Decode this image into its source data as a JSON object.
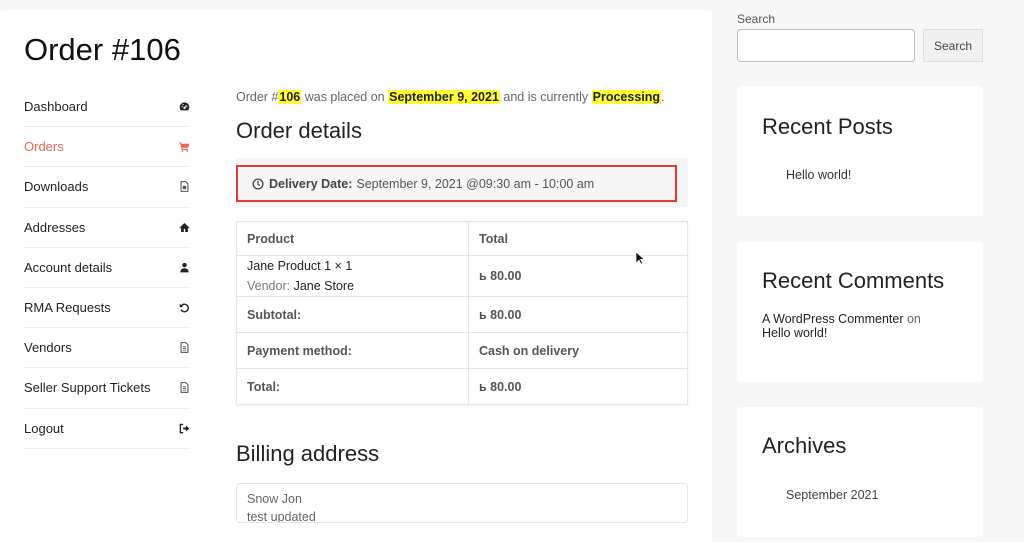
{
  "page": {
    "title": "Order #106"
  },
  "account_nav": {
    "items": [
      {
        "label": "Dashboard",
        "icon": "dashboard-icon",
        "active": false
      },
      {
        "label": "Orders",
        "icon": "cart-icon",
        "active": true
      },
      {
        "label": "Downloads",
        "icon": "file-icon",
        "active": false
      },
      {
        "label": "Addresses",
        "icon": "home-icon",
        "active": false
      },
      {
        "label": "Account details",
        "icon": "user-icon",
        "active": false
      },
      {
        "label": "RMA Requests",
        "icon": "undo-icon",
        "active": false
      },
      {
        "label": "Vendors",
        "icon": "file-icon",
        "active": false
      },
      {
        "label": "Seller Support Tickets",
        "icon": "file-icon",
        "active": false
      },
      {
        "label": "Logout",
        "icon": "logout-icon",
        "active": false
      }
    ],
    "active_color": "#e26a5b"
  },
  "order": {
    "intro_prefix": "Order #",
    "number": "106",
    "intro_mid": " was placed on ",
    "date": "September 9, 2021",
    "intro_mid2": " and is currently ",
    "status": "Processing",
    "intro_suffix": ".",
    "details_heading": "Order details",
    "delivery_label": "Delivery Date:",
    "delivery_value": "September 9, 2021 @09:30 am - 10:00 am",
    "table": {
      "headers": [
        "Product",
        "Total"
      ],
      "product": {
        "name": "Jane Product 1 × 1",
        "vendor_label": "Vendor:",
        "vendor": "Jane Store",
        "total": "ь 80.00"
      },
      "rows": [
        {
          "label": "Subtotal:",
          "value": "ь 80.00"
        },
        {
          "label": "Payment method:",
          "value": "Cash on delivery"
        },
        {
          "label": "Total:",
          "value": "ь 80.00"
        }
      ]
    },
    "billing_heading": "Billing address",
    "billing_lines": [
      "Snow Jon",
      "test updated"
    ]
  },
  "sidebar": {
    "search_label": "Search",
    "search_placeholder": "",
    "search_button": "Search",
    "recent_posts": {
      "title": "Recent Posts",
      "items": [
        "Hello world!"
      ]
    },
    "recent_comments": {
      "title": "Recent Comments",
      "author": "A WordPress Commenter",
      "on": " on ",
      "post": "Hello world!"
    },
    "archives": {
      "title": "Archives",
      "items": [
        "September 2021"
      ]
    }
  }
}
